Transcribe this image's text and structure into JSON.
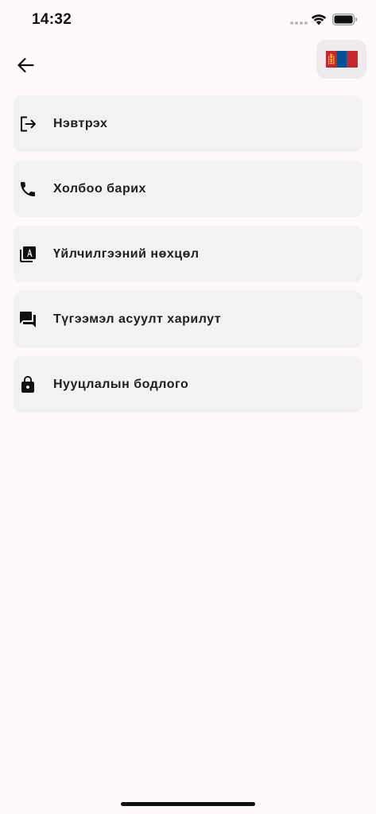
{
  "status_bar": {
    "time": "14:32"
  },
  "header": {
    "back_icon": "arrow-left-icon",
    "language_flag": "mongolia-flag-icon"
  },
  "menu": {
    "items": [
      {
        "label": "Нэвтрэх",
        "icon": "login-icon"
      },
      {
        "label": "Холбоо барих",
        "icon": "phone-icon"
      },
      {
        "label": "Үйлчилгээний нөхцөл",
        "icon": "terms-icon"
      },
      {
        "label": "Түгээмэл асуулт харилут",
        "icon": "faq-chat-icon"
      },
      {
        "label": "Нууцлалын бодлого",
        "icon": "lock-icon"
      }
    ]
  },
  "colors": {
    "background": "#fdf8fc",
    "card": "#f2f1f3",
    "flag_red": "#c4272f",
    "flag_blue": "#015197",
    "flag_yellow": "#f9cf02"
  }
}
